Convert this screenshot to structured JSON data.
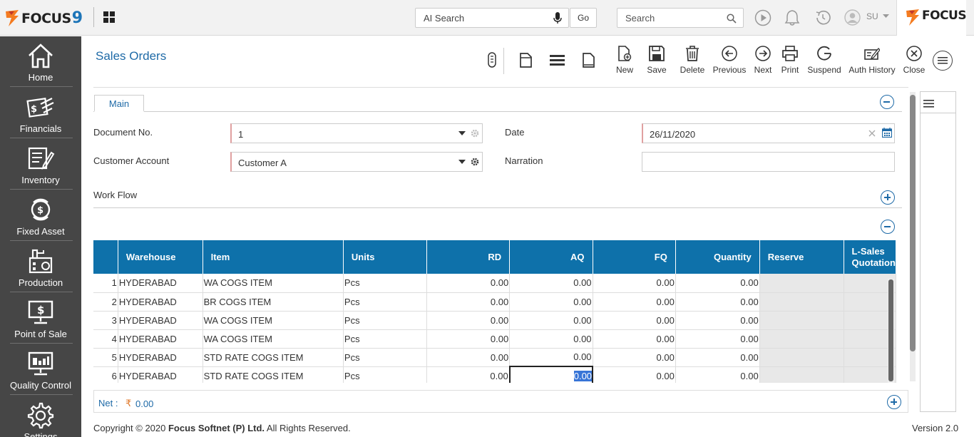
{
  "topbar": {
    "ai_search_placeholder": "AI Search",
    "go_label": "Go",
    "search_placeholder": "Search",
    "user_initials": "SU"
  },
  "sidebar": {
    "items": [
      {
        "label": "Home",
        "icon": "home-icon"
      },
      {
        "label": "Financials",
        "icon": "financials-icon"
      },
      {
        "label": "Inventory",
        "icon": "inventory-icon"
      },
      {
        "label": "Fixed Asset",
        "icon": "fixed-asset-icon"
      },
      {
        "label": "Production",
        "icon": "production-icon"
      },
      {
        "label": "Point of Sale",
        "icon": "point-of-sale-icon"
      },
      {
        "label": "Quality Control",
        "icon": "quality-control-icon"
      },
      {
        "label": "Settings",
        "icon": "settings-icon"
      }
    ]
  },
  "page": {
    "title": "Sales Orders"
  },
  "toolbar": {
    "new": "New",
    "save": "Save",
    "delete": "Delete",
    "previous": "Previous",
    "next": "Next",
    "print": "Print",
    "suspend": "Suspend",
    "auth_history": "Auth History",
    "close": "Close"
  },
  "form": {
    "tab_main": "Main",
    "document_no_label": "Document No.",
    "document_no_value": "1",
    "date_label": "Date",
    "date_value": "26/11/2020",
    "customer_account_label": "Customer Account",
    "customer_account_value": "Customer A",
    "narration_label": "Narration",
    "narration_value": "",
    "workflow_label": "Work Flow"
  },
  "grid": {
    "columns": [
      "",
      "Warehouse",
      "Item",
      "Units",
      "RD",
      "AQ",
      "FQ",
      "Quantity",
      "Reserve",
      "L-Sales Quotation"
    ],
    "rows": [
      {
        "n": "1",
        "warehouse": "HYDERABAD",
        "item": "WA COGS ITEM",
        "units": "Pcs",
        "rd": "0.00",
        "aq": "0.00",
        "fq": "0.00",
        "quantity": "0.00"
      },
      {
        "n": "2",
        "warehouse": "HYDERABAD",
        "item": "BR COGS ITEM",
        "units": "Pcs",
        "rd": "0.00",
        "aq": "0.00",
        "fq": "0.00",
        "quantity": "0.00"
      },
      {
        "n": "3",
        "warehouse": "HYDERABAD",
        "item": "WA COGS ITEM",
        "units": "Pcs",
        "rd": "0.00",
        "aq": "0.00",
        "fq": "0.00",
        "quantity": "0.00"
      },
      {
        "n": "4",
        "warehouse": "HYDERABAD",
        "item": "WA COGS ITEM",
        "units": "Pcs",
        "rd": "0.00",
        "aq": "0.00",
        "fq": "0.00",
        "quantity": "0.00"
      },
      {
        "n": "5",
        "warehouse": "HYDERABAD",
        "item": "STD RATE COGS ITEM",
        "units": "Pcs",
        "rd": "0.00",
        "aq": "0.00",
        "fq": "0.00",
        "quantity": "0.00"
      },
      {
        "n": "6",
        "warehouse": "HYDERABAD",
        "item": "STD RATE COGS ITEM",
        "units": "Pcs",
        "rd": "0.00",
        "aq": "0.00",
        "fq": "0.00",
        "quantity": "0.00"
      }
    ]
  },
  "net": {
    "label": "Net :",
    "currency_symbol": "₹",
    "value": "0.00"
  },
  "footer": {
    "copyright_prefix": "Copyright © 2020 ",
    "company": "Focus Softnet (P) Ltd.",
    "rights": " All Rights Reserved.",
    "version": "Version 2.0"
  },
  "brand": {
    "logo_text": "FOCUS",
    "logo_nine": "9",
    "brand_text": "FOCUS"
  },
  "colors": {
    "accent": "#1e6aa7",
    "grid_header": "#0e71aa",
    "sidebar": "#464646",
    "logo_orange": "#f47b20"
  }
}
